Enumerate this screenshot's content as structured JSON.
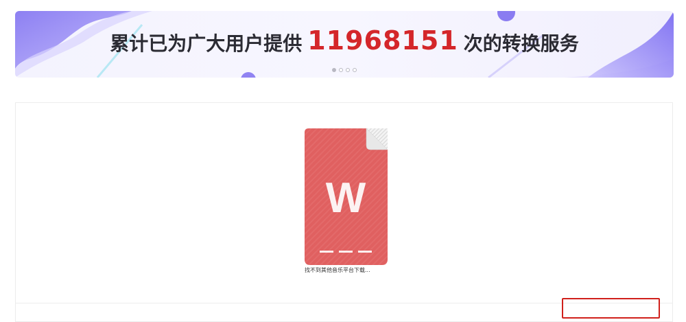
{
  "banner": {
    "prefix": "累计已为广大用户提供",
    "count": "11968151",
    "suffix": "次的转换服务",
    "slides": 4,
    "active_slide": 0
  },
  "file": {
    "icon_letter": "W",
    "name": "找不到其他音乐平台下载..."
  },
  "colors": {
    "count_red": "#d4262a",
    "file_icon_red": "#e06060",
    "highlight_border": "#d0201b",
    "banner_purple": "#8b7bf0"
  }
}
